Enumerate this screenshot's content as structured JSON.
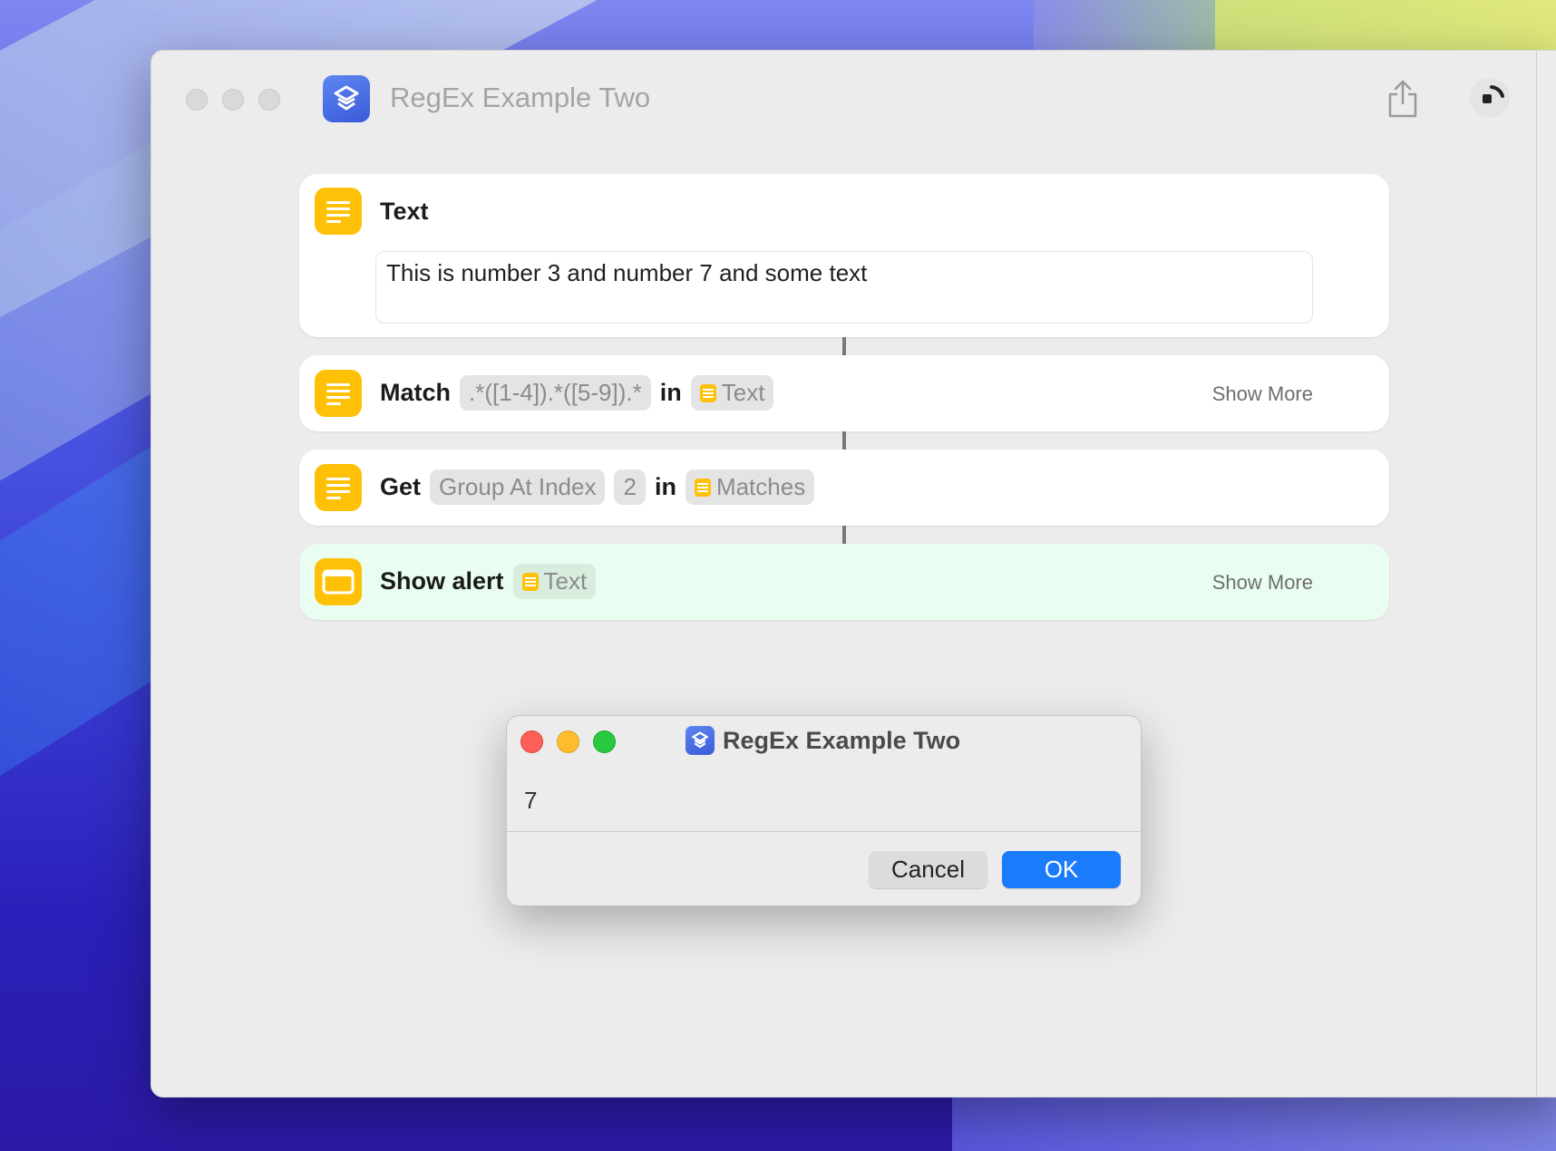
{
  "window": {
    "title": "RegEx Example Two"
  },
  "actions": {
    "text": {
      "label": "Text",
      "value": "This is number 3 and number 7 and some text"
    },
    "match": {
      "keyword": "Match",
      "pattern": ".*([1-4]).*([5-9]).*",
      "in": "in",
      "source": "Text",
      "show_more": "Show More"
    },
    "get": {
      "keyword": "Get",
      "mode": "Group At Index",
      "index": "2",
      "in": "in",
      "source": "Matches"
    },
    "alert": {
      "keyword": "Show alert",
      "source": "Text",
      "show_more": "Show More"
    }
  },
  "dialog": {
    "title": "RegEx Example Two",
    "message": "7",
    "cancel_label": "Cancel",
    "ok_label": "OK"
  },
  "colors": {
    "action_icon": "#ffc107",
    "ok_button": "#1a7cfb",
    "alert_card_bg": "#e9fdf0",
    "app_icon": "#4a6fe3"
  },
  "icons": {
    "app": "shortcuts-icon",
    "share": "share-icon",
    "run": "run-icon",
    "text_action": "text-lines-icon",
    "alert_action": "window-alert-icon"
  }
}
